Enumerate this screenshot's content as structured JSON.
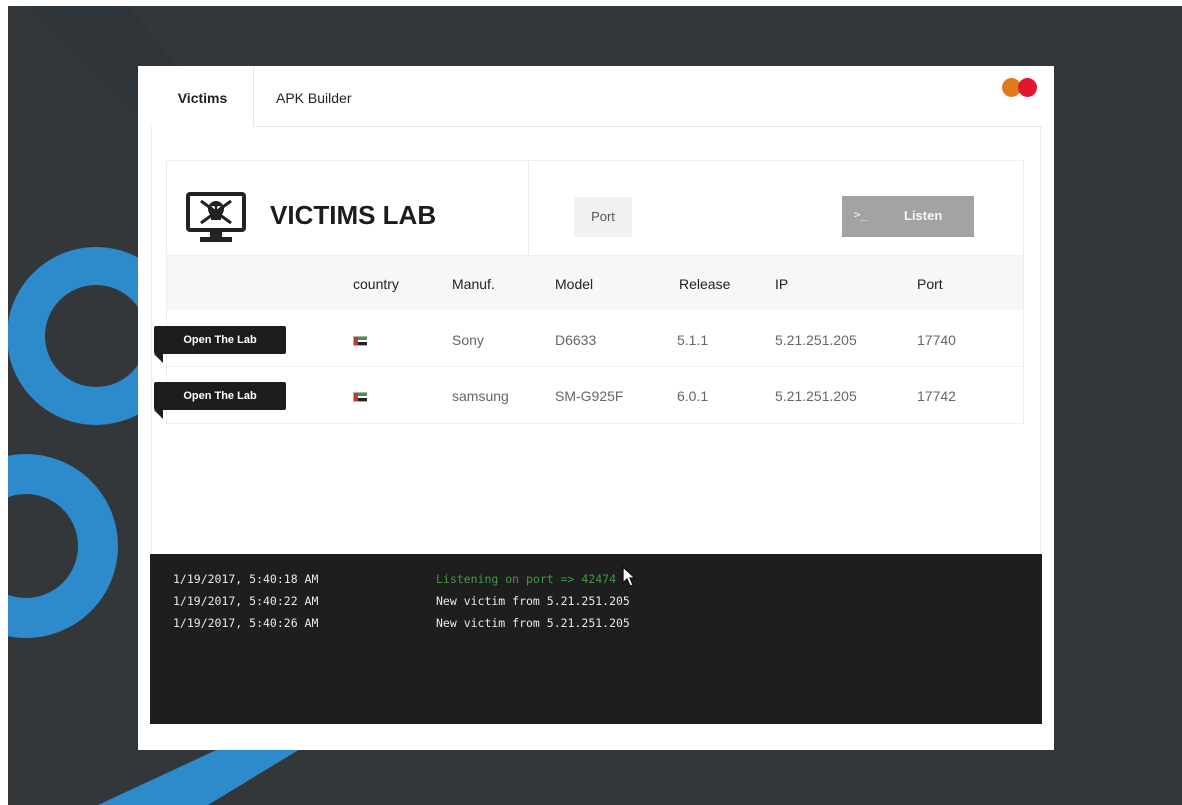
{
  "tabs": [
    {
      "label": "Victims",
      "active": true
    },
    {
      "label": "APK Builder",
      "active": false
    }
  ],
  "header": {
    "title": "VICTIMS LAB",
    "port_label": "Port",
    "port_placeholder": "",
    "listen_icon": ">_",
    "listen_label": "Listen"
  },
  "table": {
    "columns": [
      "country",
      "Manuf.",
      "Model",
      "Release",
      "IP",
      "Port"
    ],
    "rows": [
      {
        "action": "Open The Lab",
        "country_flag": "flag-icon",
        "manufacturer": "Sony",
        "model": "D6633",
        "release": "5.1.1",
        "ip": "5.21.251.205",
        "port": "17740"
      },
      {
        "action": "Open The Lab",
        "country_flag": "flag-icon",
        "manufacturer": "samsung",
        "model": "SM-G925F",
        "release": "6.0.1",
        "ip": "5.21.251.205",
        "port": "17742"
      }
    ]
  },
  "console": {
    "entries": [
      {
        "time": "1/19/2017, 5:40:18 AM",
        "message": "Listening on port => 42474",
        "status": "success"
      },
      {
        "time": "1/19/2017, 5:40:22 AM",
        "message": "New victim from 5.21.251.205",
        "status": "info"
      },
      {
        "time": "1/19/2017, 5:40:26 AM",
        "message": "New victim from 5.21.251.205",
        "status": "info"
      }
    ]
  },
  "colors": {
    "window_orange": "#e07a1c",
    "window_red": "#e0172e",
    "desktop_bg": "#34373a",
    "accent_blue": "#2d8acb",
    "success_green": "#3f9a3f"
  }
}
